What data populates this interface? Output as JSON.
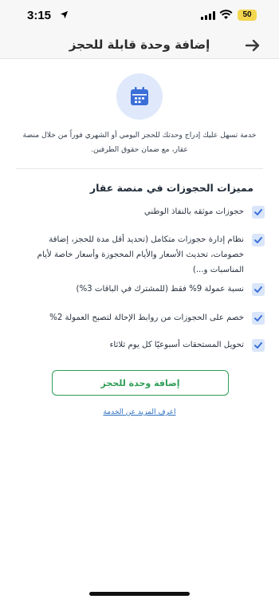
{
  "status_bar": {
    "time": "3:15",
    "battery": "50"
  },
  "header": {
    "title": "إضافة وحدة قابلة للحجز"
  },
  "intro": {
    "text": "خدمة تسهل عليك إدراج وحدتك للحجز اليومي أو الشهري فوراً من خلال منصة عقار، مع ضمان حقوق الطرفين."
  },
  "features": {
    "title": "مميزات الحجوزات في منصة عقار",
    "items": [
      {
        "label": "حجوزات موثقه بالنفاذ الوطني"
      },
      {
        "label": "نظام إدارة حجوزات متكامل (تحديد أقل مدة للحجز، إضافة خصومات، تحديث الأسعار والأيام المحجوزة وأسعار خاصة لأيام المناسبات و...)"
      },
      {
        "label": "نسبة عمولة 9% فقط (للمشترك في الباقات 3%)"
      },
      {
        "label": "خصم على الحجوزات من روابط الإحالة لتصبح العمولة 2%"
      },
      {
        "label": "تحويل المستحقات أسبوعيًا كل يوم ثلاثاء"
      }
    ]
  },
  "actions": {
    "add_unit": "إضافة وحدة للحجز",
    "learn_more": "اعرف المزيد عن الخدمة"
  },
  "colors": {
    "accent_green": "#2e9e56",
    "accent_blue": "#3b6fd8",
    "link_blue": "#2c6fbf"
  },
  "icons": {
    "back": "arrow-right-icon",
    "hero": "calendar-icon",
    "check": "check-icon"
  }
}
